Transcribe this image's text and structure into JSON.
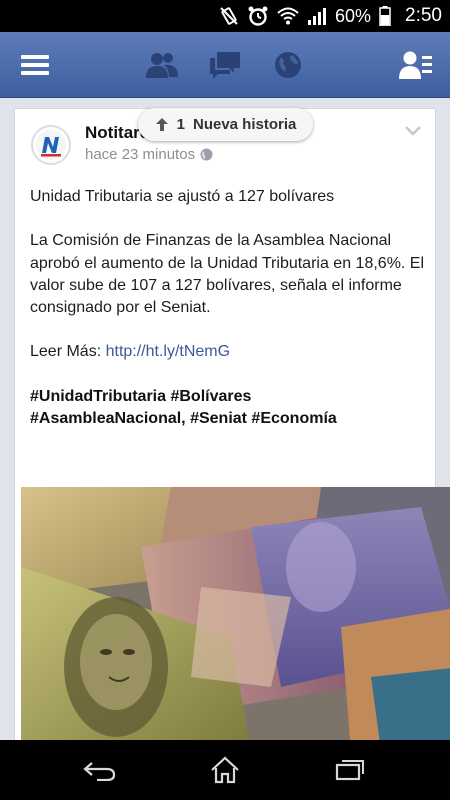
{
  "status_bar": {
    "battery": "60%",
    "time": "2:50",
    "icons": [
      "vibrate-icon",
      "alarm-icon",
      "wifi-icon",
      "signal-icon",
      "battery-icon"
    ]
  },
  "nav": {
    "icons": [
      "menu-icon",
      "friend-requests-icon",
      "messages-icon",
      "notifications-globe-icon",
      "contacts-icon"
    ]
  },
  "new_stories": {
    "count": "1",
    "label": "Nueva historia"
  },
  "post": {
    "author": "Notitarde",
    "timestamp": "hace 23 minutos",
    "headline": "Unidad Tributaria se ajustó a 127 bolívares",
    "body": "La Comisión de Finanzas de la Asamblea Nacional aprobó el aumento de la Unidad Tributaria en 18,6%. El valor sube de 107 a 127 bolívares, señala el informe consignado por el Seniat.",
    "read_more_label": "Leer Más:",
    "read_more_url": "http://ht.ly/tNemG",
    "hashtags_line1": "#UnidadTributaria #Bolívares",
    "hashtags_line2": "#AsambleaNacional, #Seniat #Economía",
    "image_description": "Billetes venezolanos"
  },
  "colors": {
    "nav_top": "#5e7cb9",
    "nav_bottom": "#3e5e9f",
    "link": "#3b5998"
  }
}
